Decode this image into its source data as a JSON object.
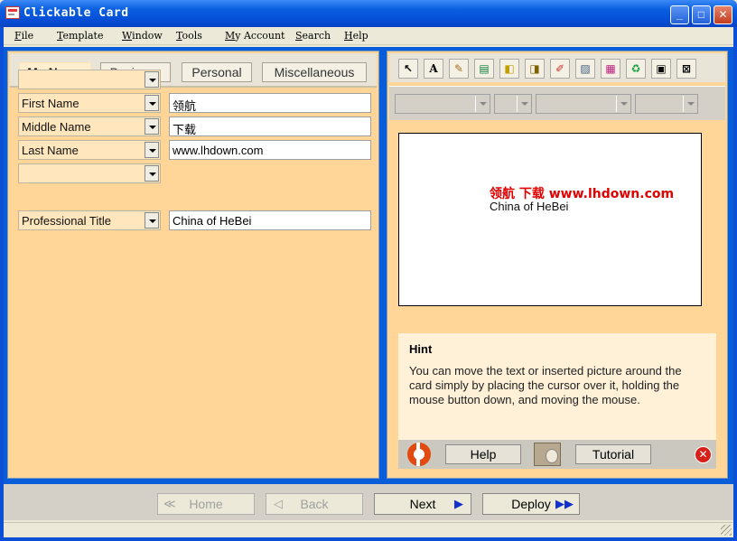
{
  "window": {
    "title": "Clickable Card"
  },
  "menu": [
    "File",
    "Template",
    "Window",
    "Tools",
    "My Account",
    "Search",
    "Help"
  ],
  "tabs": [
    "My Name",
    "Business",
    "Personal",
    "Miscellaneous"
  ],
  "active_tab": "My Name",
  "name_fields": [
    {
      "label": "",
      "value": ""
    },
    {
      "label": "First Name",
      "value": "领航"
    },
    {
      "label": "Middle Name",
      "value": "下载"
    },
    {
      "label": "Last Name",
      "value": "www.lhdown.com"
    },
    {
      "label": "",
      "value": ""
    }
  ],
  "title_field": {
    "label": "Professional Title",
    "value": "China  of HeBei"
  },
  "toolbar_icons": [
    "pointer-icon",
    "text-icon",
    "edit-icon",
    "layer-icon",
    "bring-front-icon",
    "send-back-icon",
    "eraser-icon",
    "image-icon",
    "color-palette-icon",
    "recycle-icon",
    "fit-icon",
    "grid-icon"
  ],
  "card": {
    "line1": "领航 下载 www.lhdown.com",
    "line2": "China  of HeBei",
    "line1_color": "#e00000"
  },
  "hint": {
    "title": "Hint",
    "body": "You can move the text or inserted picture around the card simply by placing the cursor over it, holding the mouse button down, and moving the mouse."
  },
  "hint_buttons": {
    "help": "Help",
    "tutorial": "Tutorial"
  },
  "nav": {
    "home": "Home",
    "back": "Back",
    "next": "Next",
    "deploy": "Deploy"
  },
  "colors": {
    "panel": "#ffd598",
    "work_area": "#0a5dd8",
    "accent_arrow": "#1030d0"
  }
}
